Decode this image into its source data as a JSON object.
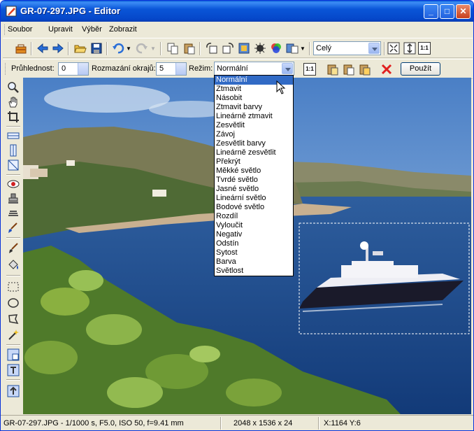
{
  "window": {
    "title": "GR-07-297.JPG - Editor",
    "minimize": "_",
    "maximize": "□",
    "close": "✕"
  },
  "menu": [
    "Soubor",
    "Upravit",
    "Výběr",
    "Zobrazit"
  ],
  "toolbar1": {
    "zoom_value": "Celý",
    "icons": [
      "toolbox-icon",
      "back-arrow-icon",
      "forward-arrow-icon",
      "open-folder-icon",
      "save-disk-icon",
      "undo-icon",
      "redo-icon",
      "copy-icon",
      "paste-icon",
      "rotate-left-icon",
      "rotate-right-icon",
      "resize-icon",
      "sharpen-icon",
      "color-wheel-icon",
      "convert-icon",
      "fit-window-icon",
      "fit-height-icon",
      "actual-size-icon"
    ],
    "actual_size_label": "1:1"
  },
  "toolbar2": {
    "opacity_label": "Průhlednost:",
    "opacity_value": "0",
    "blur_label": "Rozmazání okrajů:",
    "blur_value": "5",
    "mode_label": "Režim:",
    "mode_value": "Normální",
    "one_to_one": "1:1",
    "apply_button": "Použít"
  },
  "blend_modes": [
    "Normální",
    "Ztmavit",
    "Násobit",
    "Ztmavit barvy",
    "Lineárně ztmavit",
    "Zesvětlit",
    "Závoj",
    "Zesvětlit barvy",
    "Lineárně zesvětlit",
    "Překrýt",
    "Měkké světlo",
    "Tvrdé světlo",
    "Jasné světlo",
    "Lineární světlo",
    "Bodové světlo",
    "Rozdíl",
    "Vyloučit",
    "Negativ",
    "Odstín",
    "Sytost",
    "Barva",
    "Světlost"
  ],
  "selected_blend_mode_index": 0,
  "palette_tools": [
    "zoom-icon",
    "hand-pan-icon",
    "crop-icon",
    "horizontal-line-icon",
    "vertical-line-icon",
    "straighten-icon",
    "red-eye-icon",
    "clone-stamp-icon",
    "smudge-icon",
    "brush-color-icon",
    "paintbrush-icon",
    "fill-bucket-icon",
    "rect-select-icon",
    "ellipse-select-icon",
    "lasso-select-icon",
    "magic-wand-icon",
    "layer-icon",
    "text-icon",
    "export-icon"
  ],
  "status": {
    "file_info": "GR-07-297.JPG - 1/1000 s, F5.0, ISO 50, f=9.41 mm",
    "dimensions": "2048 x 1536 x 24",
    "coords": "X:1164  Y:6"
  },
  "colors": {
    "titlebar": "#0a56d8",
    "selection_highlight": "#316ac5",
    "chrome": "#ece9d8"
  }
}
